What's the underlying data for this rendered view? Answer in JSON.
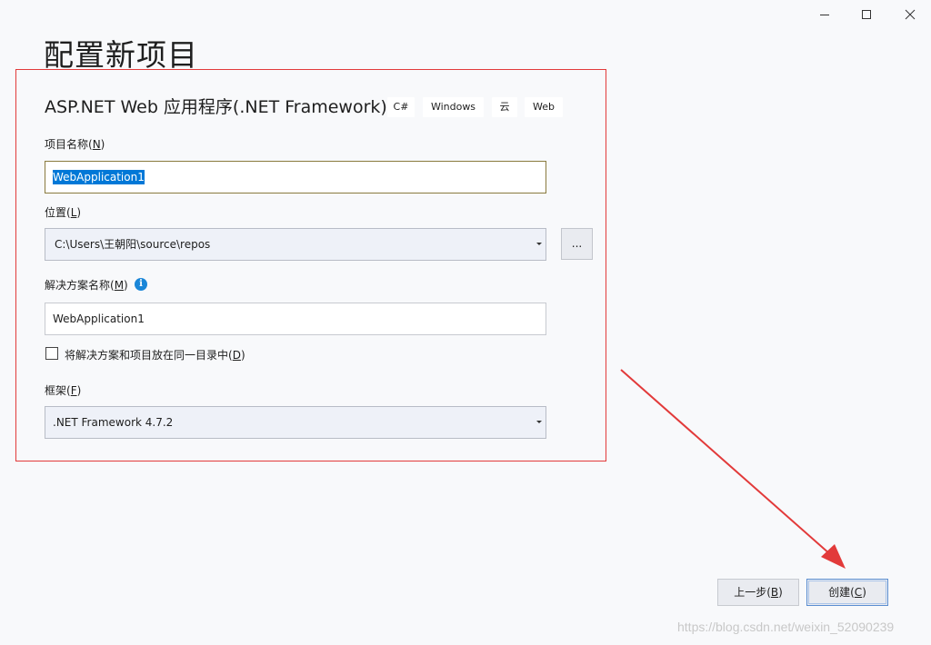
{
  "window": {
    "controls": {
      "minimize": "minimize-icon",
      "maximize": "maximize-icon",
      "close": "close-icon"
    }
  },
  "page": {
    "title": "配置新项目"
  },
  "template": {
    "name": "ASP.NET Web 应用程序(.NET Framework)",
    "tags": [
      "C#",
      "Windows",
      "云",
      "Web"
    ]
  },
  "project_name": {
    "label": "项目名称(",
    "accesskey": "N",
    "label_end": ")",
    "value": "WebApplication1"
  },
  "location": {
    "label": "位置(",
    "accesskey": "L",
    "label_end": ")",
    "value": "C:\\Users\\王朝阳\\source\\repos",
    "browse_label": "..."
  },
  "solution_name": {
    "label": "解决方案名称(",
    "accesskey": "M",
    "label_end": ")",
    "info_icon": "i",
    "value": "WebApplication1"
  },
  "same_dir": {
    "label": "将解决方案和项目放在同一目录中(",
    "accesskey": "D",
    "label_end": ")",
    "checked": false
  },
  "framework": {
    "label": "框架(",
    "accesskey": "F",
    "label_end": ")",
    "value": ".NET Framework 4.7.2"
  },
  "buttons": {
    "back": {
      "label": "上一步(",
      "accesskey": "B",
      "label_end": ")"
    },
    "create": {
      "label": "创建(",
      "accesskey": "C",
      "label_end": ")"
    }
  },
  "watermark": "https://blog.csdn.net/weixin_52090239",
  "colors": {
    "annotation_red": "#e23a3a",
    "selection_blue": "#0078d7",
    "info_blue": "#1a86d8"
  }
}
